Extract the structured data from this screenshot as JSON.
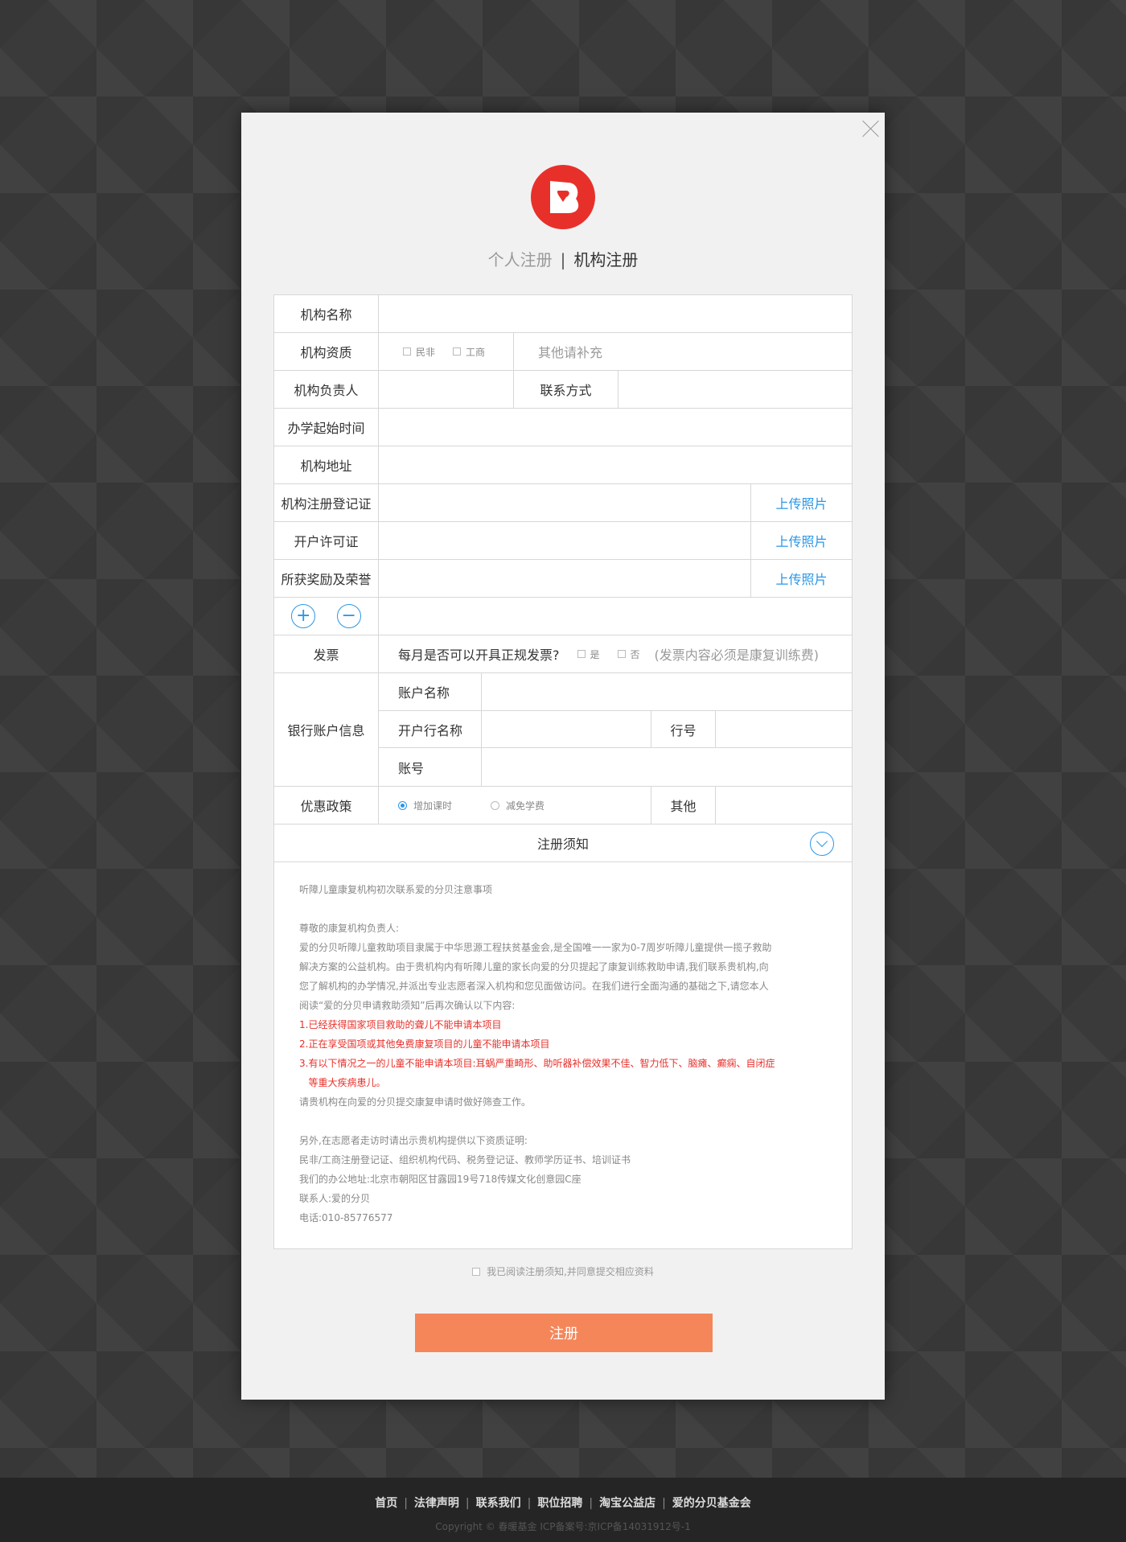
{
  "tabs": {
    "personal": "个人注册",
    "separator": "|",
    "org": "机构注册"
  },
  "form": {
    "org_name_label": "机构名称",
    "qualification_label": "机构资质",
    "qual_opt1": "民非",
    "qual_opt2": "工商",
    "qual_other_placeholder": "其他请补充",
    "leader_label": "机构负责人",
    "contact_label": "联系方式",
    "start_time_label": "办学起始时间",
    "address_label": "机构地址",
    "reg_cert_label": "机构注册登记证",
    "account_permit_label": "开户许可证",
    "awards_label": "所获奖励及荣誉",
    "upload_label": "上传照片",
    "add_symbol": "+",
    "remove_symbol": "−",
    "invoice_label": "发票",
    "invoice_question": "每月是否可以开具正规发票?",
    "invoice_yes": "是",
    "invoice_no": "否",
    "invoice_note": "(发票内容必须是康复训练费)",
    "bank_label": "银行账户信息",
    "account_name_label": "账户名称",
    "bank_name_label": "开户行名称",
    "bank_code_label": "行号",
    "account_no_label": "账号",
    "discount_label": "优惠政策",
    "discount_opt1": "增加课时",
    "discount_opt2": "减免学费",
    "other_label": "其他"
  },
  "notice": {
    "title": "注册须知",
    "lines": [
      "听障儿童康复机构初次联系爱的分贝注意事项",
      "",
      "尊敬的康复机构负责人:",
      "爱的分贝听障儿童救助项目隶属于中华思源工程扶贫基金会,是全国唯一一家为0-7周岁听障儿童提供一揽子救助",
      "解决方案的公益机构。由于贵机构内有听障儿童的家长向爱的分贝提起了康复训练救助申请,我们联系贵机构,向",
      "您了解机构的办学情况,并派出专业志愿者深入机构和您见面做访问。在我们进行全面沟通的基础之下,请您本人",
      "阅读“爱的分贝申请救助须知”后再次确认以下内容:"
    ],
    "red_lines": [
      "1.已经获得国家项目救助的聋儿不能申请本项目",
      "2.正在享受国项或其他免费康复项目的儿童不能申请本项目",
      "3.有以下情况之一的儿童不能申请本项目:耳蜗严重畸形、助听器补偿效果不佳、智力低下、脑瘫、癫痫、自闭症",
      "   等重大疾病患儿。"
    ],
    "tail_lines": [
      "请贵机构在向爱的分贝提交康复申请时做好筛查工作。",
      "",
      "另外,在志愿者走访时请出示贵机构提供以下资质证明:",
      "民非/工商注册登记证、组织机构代码、税务登记证、教师学历证书、培训证书",
      "我们的办公地址:北京市朝阳区甘露园19号718传媒文化创意园C座",
      "联系人:爱的分贝",
      "电话:010-85776577"
    ]
  },
  "agree_text": "我已阅读注册须知,并同意提交相应资料",
  "submit_label": "注册",
  "footer": {
    "links": [
      "首页",
      "法律声明",
      "联系我们",
      "职位招聘",
      "淘宝公益店",
      "爱的分贝基金会"
    ],
    "copyright": "Copyright © 春暖基金 ICP备案号:京ICP备14031912号-1"
  },
  "colors": {
    "accent": "#2a97e8",
    "submit": "#f5865a",
    "logo_red": "#e8302a",
    "warning": "#e8302a"
  }
}
